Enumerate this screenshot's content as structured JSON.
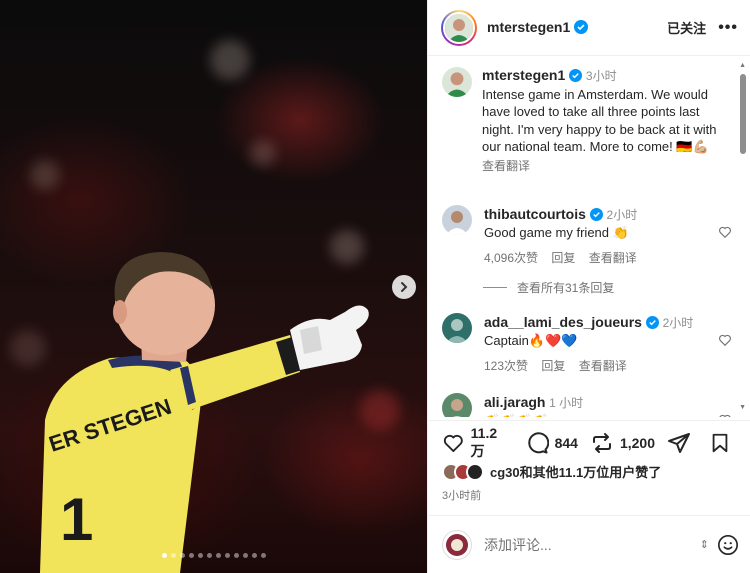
{
  "photo": {
    "jersey_text": "ER STEGEN",
    "jersey_number": "1",
    "dots_count": 12,
    "active_dot": 0
  },
  "header": {
    "username": "mterstegen1",
    "follow_label": "已关注",
    "more_icon": "more-horizontal-icon"
  },
  "caption": {
    "username": "mterstegen1",
    "time": "3小时",
    "text": "Intense game in Amsterdam. We would have loved to take all three points last night. I'm very happy to be back at it with our national team. More to come! 🇩🇪💪🏼",
    "translate": "查看翻译"
  },
  "comments": [
    {
      "username": "thibautcourtois",
      "time": "2小时",
      "text": "Good game my friend 👏",
      "likes": "4,096次赞",
      "reply": "回复",
      "translate": "查看翻译",
      "avatar_color": "#c9d2dc"
    },
    {
      "username": "ada__lami_des_joueurs",
      "time": "2小时",
      "text": "Captain🔥❤️💙",
      "likes": "123次赞",
      "reply": "回复",
      "translate": "查看翻译",
      "avatar_color": "#2f6f6a"
    },
    {
      "username": "ali.jaragh",
      "time": "1 小时",
      "text": "👏👏👏👏",
      "avatar_color": "#5a8a6a"
    }
  ],
  "view_replies": "查看所有31条回复",
  "actions": {
    "likes_count": "11.2 万",
    "comments_count": "844",
    "reposts_count": "1,200"
  },
  "liked_by": "cg30和其他11.1万位用户赞了",
  "time_ago": "3小时前",
  "add_comment": {
    "placeholder": "添加评论..."
  },
  "colors": {
    "verified_blue": "#0095f6",
    "jersey_yellow": "#f2e45a",
    "jersey_navy": "#2a3566"
  }
}
